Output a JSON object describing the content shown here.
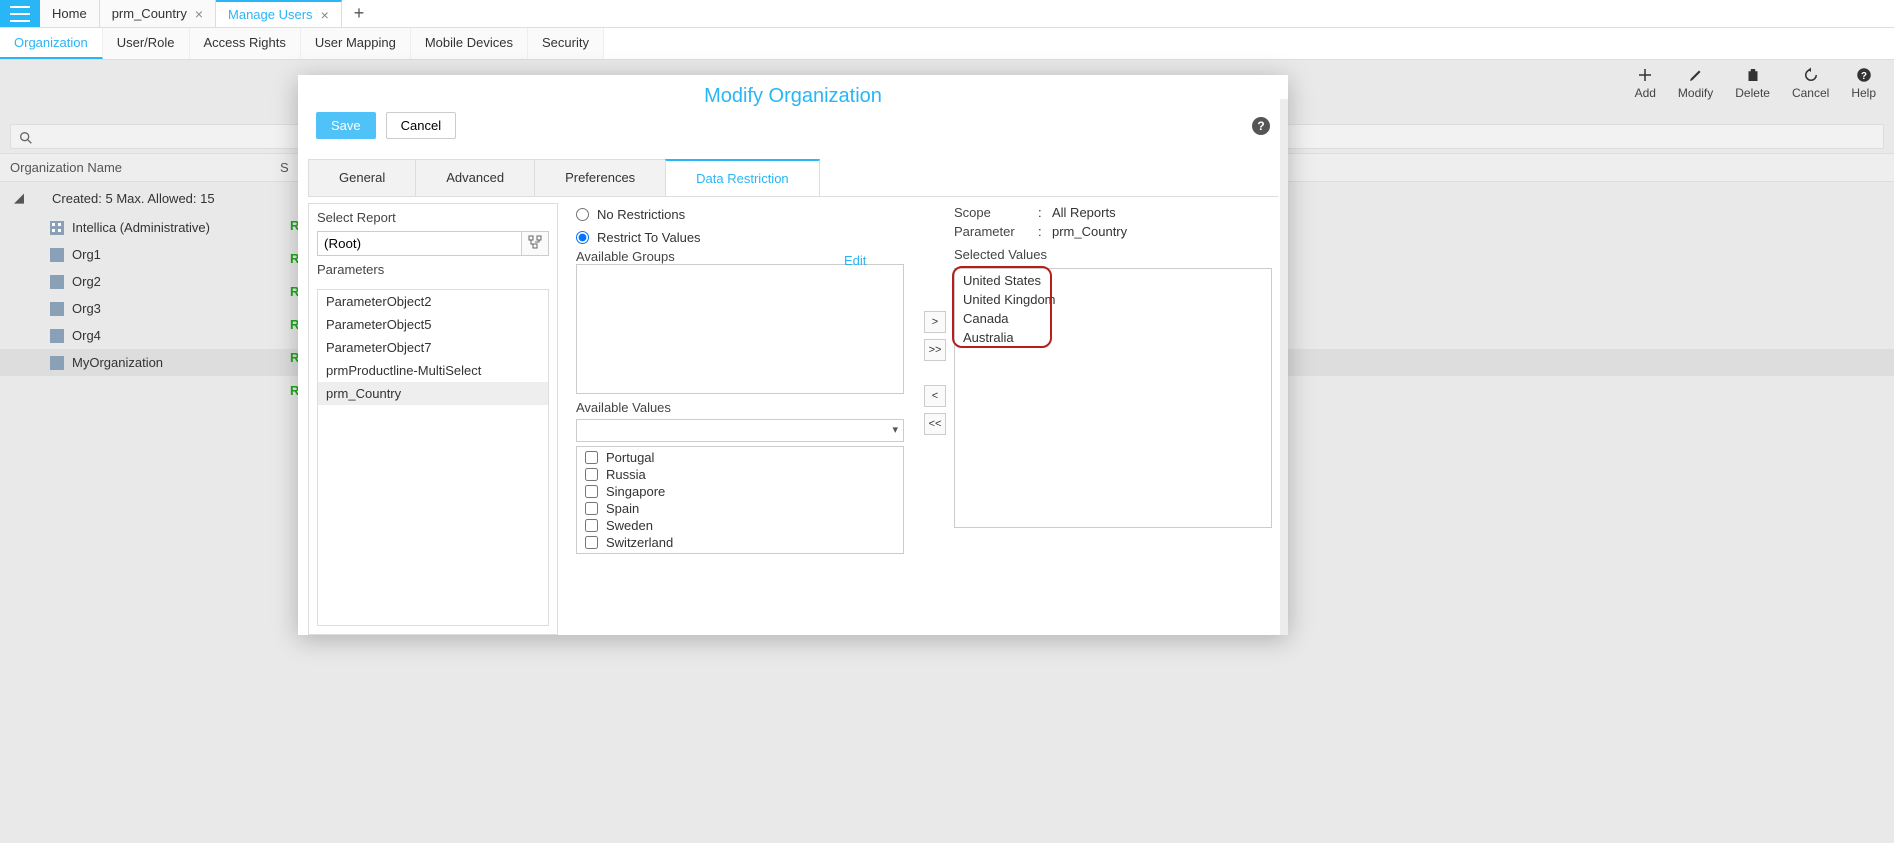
{
  "topTabs": {
    "home": "Home",
    "t1": "prm_Country",
    "t2": "Manage Users"
  },
  "subTabs": {
    "organization": "Organization",
    "userRole": "User/Role",
    "accessRights": "Access Rights",
    "userMapping": "User Mapping",
    "mobileDevices": "Mobile Devices",
    "security": "Security"
  },
  "page": {
    "title": "Organization",
    "searchPlaceholder": "",
    "gridCol1": "Organization Name",
    "gridCol2Initial": "S",
    "status": "Created:  5  Max. Allowed:  15"
  },
  "toolbar": {
    "add": "Add",
    "modify": "Modify",
    "delete": "Delete",
    "cancel": "Cancel",
    "help": "Help"
  },
  "tree": [
    "Intellica (Administrative)",
    "Org1",
    "Org2",
    "Org3",
    "Org4",
    "MyOrganization"
  ],
  "modal": {
    "title": "Modify Organization",
    "save": "Save",
    "cancel": "Cancel",
    "tabs": {
      "general": "General",
      "advanced": "Advanced",
      "preferences": "Preferences",
      "data": "Data Restriction"
    },
    "selectReport": "Select Report",
    "root": "(Root)",
    "parametersLbl": "Parameters",
    "radios": {
      "none": "No Restrictions",
      "restrict": "Restrict To Values"
    },
    "availGroups": "Available Groups",
    "edit": "Edit",
    "availValues": "Available Values",
    "scopeLbl": "Scope",
    "scopeVal": "All Reports",
    "paramLbl": "Parameter",
    "paramVal": "prm_Country",
    "selValuesLbl": "Selected Values"
  },
  "parameters": [
    "ParameterObject2",
    "ParameterObject5",
    "ParameterObject7",
    "prmProductline-MultiSelect",
    "prm_Country"
  ],
  "availableValues": [
    "Portugal",
    "Russia",
    "Singapore",
    "Spain",
    "Sweden",
    "Switzerland"
  ],
  "selectedValues": [
    "United States",
    "United Kingdom",
    "Canada",
    "Australia"
  ]
}
